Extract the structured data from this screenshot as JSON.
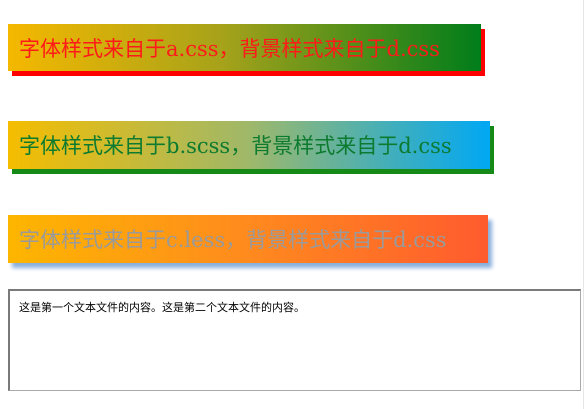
{
  "boxes": [
    {
      "text": "字体样式来自于a.css，背景样式来自于d.css",
      "color": "#ff1a1a"
    },
    {
      "text": "字体样式来自于b.scss，背景样式来自于d.css",
      "color": "#0c7a2f"
    },
    {
      "text": "字体样式来自于c.less，背景样式来自于d.css",
      "color": "#9a9a9a"
    }
  ],
  "textarea": {
    "value": "这是第一个文本文件的内容。这是第二个文本文件的内容。"
  }
}
